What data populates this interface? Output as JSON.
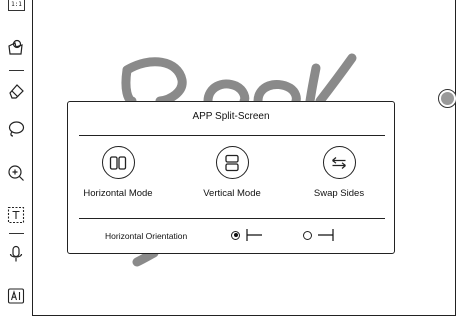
{
  "toolbar": {
    "ratio_badge": "1:1",
    "tools": [
      "lasso-shape-icon",
      "eraser-icon",
      "lasso-select-icon",
      "zoom-in-icon",
      "text-box-icon",
      "microphone-icon",
      "ai-icon"
    ]
  },
  "canvas": {
    "handwriting_color": "#8a8a8a"
  },
  "dialog": {
    "title": "APP Split-Screen",
    "options": [
      {
        "label": "Horizontal Mode",
        "icon": "horizontal-mode-icon"
      },
      {
        "label": "Vertical Mode",
        "icon": "vertical-mode-icon"
      },
      {
        "label": "Swap Sides",
        "icon": "swap-sides-icon"
      }
    ],
    "orientation": {
      "label": "Horizontal Orientation",
      "choices": [
        {
          "icon": "divider-left-icon",
          "selected": true
        },
        {
          "icon": "divider-right-icon",
          "selected": false
        }
      ]
    }
  }
}
